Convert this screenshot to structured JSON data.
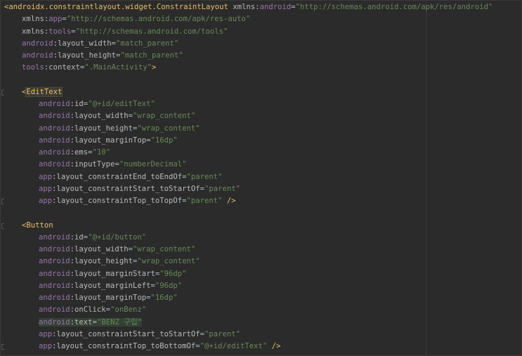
{
  "editor": {
    "language": "xml",
    "colors": {
      "background": "#2b2b2b",
      "namespace": "#9876aa",
      "attribute": "#bababa",
      "value": "#6a8759",
      "tag": "#e8bf6a",
      "text": "#a9b7c6"
    },
    "lines": [
      {
        "indent": 0,
        "parts": [
          {
            "t": "punc",
            "s": "<"
          },
          {
            "t": "tag",
            "s": "androidx.constraintlayout.widget.ConstraintLayout"
          },
          {
            "t": "text",
            "s": " "
          },
          {
            "t": "attr",
            "s": "xmlns:"
          },
          {
            "t": "ns",
            "s": "android"
          },
          {
            "t": "text",
            "s": "="
          },
          {
            "t": "val",
            "s": "\"http://schemas.android.com/apk/res/android\""
          }
        ]
      },
      {
        "indent": 1,
        "parts": [
          {
            "t": "attr",
            "s": "xmlns:"
          },
          {
            "t": "ns",
            "s": "app"
          },
          {
            "t": "text",
            "s": "="
          },
          {
            "t": "val",
            "s": "\"http://schemas.android.com/apk/res-auto\""
          }
        ]
      },
      {
        "indent": 1,
        "parts": [
          {
            "t": "attr",
            "s": "xmlns:"
          },
          {
            "t": "ns",
            "s": "tools"
          },
          {
            "t": "text",
            "s": "="
          },
          {
            "t": "val",
            "s": "\"http://schemas.android.com/tools\""
          }
        ]
      },
      {
        "indent": 1,
        "parts": [
          {
            "t": "ns",
            "s": "android"
          },
          {
            "t": "attr",
            "s": ":layout_width"
          },
          {
            "t": "text",
            "s": "="
          },
          {
            "t": "val",
            "s": "\"match_parent\""
          }
        ]
      },
      {
        "indent": 1,
        "parts": [
          {
            "t": "ns",
            "s": "android"
          },
          {
            "t": "attr",
            "s": ":layout_height"
          },
          {
            "t": "text",
            "s": "="
          },
          {
            "t": "val",
            "s": "\"match_parent\""
          }
        ]
      },
      {
        "indent": 1,
        "parts": [
          {
            "t": "ns",
            "s": "tools"
          },
          {
            "t": "attr",
            "s": ":context"
          },
          {
            "t": "text",
            "s": "="
          },
          {
            "t": "val",
            "s": "\".MainActivity\""
          },
          {
            "t": "punc",
            "s": ">"
          }
        ]
      },
      {
        "indent": 1,
        "parts": []
      },
      {
        "indent": 1,
        "fold": true,
        "parts": [
          {
            "t": "punc",
            "s": "<"
          },
          {
            "t": "tag",
            "s": "EditText",
            "hl": "tag"
          }
        ]
      },
      {
        "indent": 2,
        "parts": [
          {
            "t": "ns",
            "s": "android"
          },
          {
            "t": "attr",
            "s": ":id"
          },
          {
            "t": "text",
            "s": "="
          },
          {
            "t": "val",
            "s": "\"@+id/editText\""
          }
        ]
      },
      {
        "indent": 2,
        "parts": [
          {
            "t": "ns",
            "s": "android"
          },
          {
            "t": "attr",
            "s": ":layout_width"
          },
          {
            "t": "text",
            "s": "="
          },
          {
            "t": "val",
            "s": "\"wrap_content\""
          }
        ]
      },
      {
        "indent": 2,
        "parts": [
          {
            "t": "ns",
            "s": "android"
          },
          {
            "t": "attr",
            "s": ":layout_height"
          },
          {
            "t": "text",
            "s": "="
          },
          {
            "t": "val",
            "s": "\"wrap_content\""
          }
        ]
      },
      {
        "indent": 2,
        "parts": [
          {
            "t": "ns",
            "s": "android"
          },
          {
            "t": "attr",
            "s": ":layout_marginTop"
          },
          {
            "t": "text",
            "s": "="
          },
          {
            "t": "val",
            "s": "\"16dp\""
          }
        ]
      },
      {
        "indent": 2,
        "parts": [
          {
            "t": "ns",
            "s": "android"
          },
          {
            "t": "attr",
            "s": ":ems"
          },
          {
            "t": "text",
            "s": "="
          },
          {
            "t": "val",
            "s": "\"10\""
          }
        ]
      },
      {
        "indent": 2,
        "parts": [
          {
            "t": "ns",
            "s": "android"
          },
          {
            "t": "attr",
            "s": ":inputType"
          },
          {
            "t": "text",
            "s": "="
          },
          {
            "t": "val",
            "s": "\"numberDecimal\""
          }
        ]
      },
      {
        "indent": 2,
        "parts": [
          {
            "t": "ns",
            "s": "app"
          },
          {
            "t": "attr",
            "s": ":layout_constraintEnd_toEndOf"
          },
          {
            "t": "text",
            "s": "="
          },
          {
            "t": "val",
            "s": "\"parent\""
          }
        ]
      },
      {
        "indent": 2,
        "parts": [
          {
            "t": "ns",
            "s": "app"
          },
          {
            "t": "attr",
            "s": ":layout_constraintStart_toStartOf"
          },
          {
            "t": "text",
            "s": "="
          },
          {
            "t": "val",
            "s": "\"parent\""
          }
        ]
      },
      {
        "indent": 2,
        "fold": true,
        "parts": [
          {
            "t": "ns",
            "s": "app"
          },
          {
            "t": "attr",
            "s": ":layout_constraintTop_toTopOf"
          },
          {
            "t": "text",
            "s": "="
          },
          {
            "t": "val",
            "s": "\"parent\""
          },
          {
            "t": "text",
            "s": " "
          },
          {
            "t": "punc",
            "s": "/>"
          }
        ]
      },
      {
        "indent": 1,
        "parts": []
      },
      {
        "indent": 1,
        "fold": true,
        "parts": [
          {
            "t": "punc",
            "s": "<"
          },
          {
            "t": "tag",
            "s": "Button"
          }
        ]
      },
      {
        "indent": 2,
        "parts": [
          {
            "t": "ns",
            "s": "android"
          },
          {
            "t": "attr",
            "s": ":id"
          },
          {
            "t": "text",
            "s": "="
          },
          {
            "t": "val",
            "s": "\"@+id/button\""
          }
        ]
      },
      {
        "indent": 2,
        "parts": [
          {
            "t": "ns",
            "s": "android"
          },
          {
            "t": "attr",
            "s": ":layout_width"
          },
          {
            "t": "text",
            "s": "="
          },
          {
            "t": "val",
            "s": "\"wrap_content\""
          }
        ]
      },
      {
        "indent": 2,
        "parts": [
          {
            "t": "ns",
            "s": "android"
          },
          {
            "t": "attr",
            "s": ":layout_height"
          },
          {
            "t": "text",
            "s": "="
          },
          {
            "t": "val",
            "s": "\"wrap_content\""
          }
        ]
      },
      {
        "indent": 2,
        "parts": [
          {
            "t": "ns",
            "s": "android"
          },
          {
            "t": "attr",
            "s": ":layout_marginStart"
          },
          {
            "t": "text",
            "s": "="
          },
          {
            "t": "val",
            "s": "\"96dp\""
          }
        ]
      },
      {
        "indent": 2,
        "parts": [
          {
            "t": "ns",
            "s": "android"
          },
          {
            "t": "attr",
            "s": ":layout_marginLeft"
          },
          {
            "t": "text",
            "s": "="
          },
          {
            "t": "val",
            "s": "\"96dp\""
          }
        ]
      },
      {
        "indent": 2,
        "parts": [
          {
            "t": "ns",
            "s": "android"
          },
          {
            "t": "attr",
            "s": ":layout_marginTop"
          },
          {
            "t": "text",
            "s": "="
          },
          {
            "t": "val",
            "s": "\"16dp\""
          }
        ]
      },
      {
        "indent": 2,
        "parts": [
          {
            "t": "ns",
            "s": "android"
          },
          {
            "t": "attr",
            "s": ":onClick"
          },
          {
            "t": "text",
            "s": "="
          },
          {
            "t": "val",
            "s": "\"onBenz\""
          }
        ]
      },
      {
        "indent": 2,
        "parts": [
          {
            "t": "ns",
            "s": "android",
            "hl": "attr"
          },
          {
            "t": "attr",
            "s": ":text",
            "hl": "attr"
          },
          {
            "t": "text",
            "s": "=",
            "hl": "attr"
          },
          {
            "t": "val",
            "s": "\"BENZ 구입\"",
            "hl": "attr"
          }
        ]
      },
      {
        "indent": 2,
        "parts": [
          {
            "t": "ns",
            "s": "app"
          },
          {
            "t": "attr",
            "s": ":layout_constraintStart_toStartOf"
          },
          {
            "t": "text",
            "s": "="
          },
          {
            "t": "val",
            "s": "\"parent\""
          }
        ]
      },
      {
        "indent": 2,
        "fold": true,
        "parts": [
          {
            "t": "ns",
            "s": "app"
          },
          {
            "t": "attr",
            "s": ":layout_constraintTop_toBottomOf"
          },
          {
            "t": "text",
            "s": "="
          },
          {
            "t": "val",
            "s": "\"@+id/editText\""
          },
          {
            "t": "text",
            "s": " "
          },
          {
            "t": "punc",
            "s": "/>"
          }
        ]
      }
    ]
  }
}
